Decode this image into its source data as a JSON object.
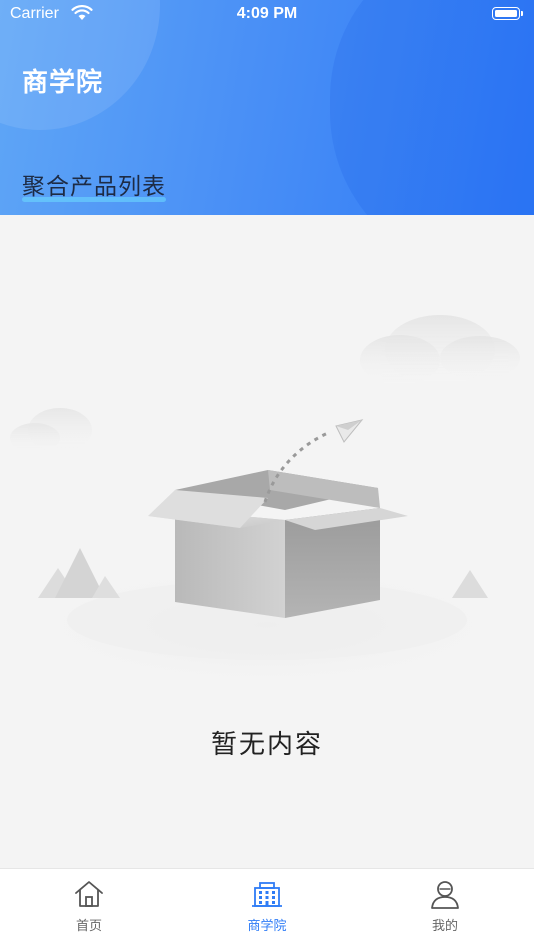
{
  "status_bar": {
    "carrier": "Carrier",
    "time": "4:09 PM"
  },
  "header": {
    "title": "商学院",
    "section_tab": "聚合产品列表"
  },
  "empty_state": {
    "message": "暂无内容"
  },
  "tab_bar": {
    "items": [
      {
        "label": "首页",
        "icon": "home-icon",
        "active": false
      },
      {
        "label": "商学院",
        "icon": "building-icon",
        "active": true
      },
      {
        "label": "我的",
        "icon": "user-icon",
        "active": false
      }
    ]
  },
  "colors": {
    "header_gradient_start": "#5fa6f6",
    "header_gradient_end": "#2e79f7",
    "active_tab": "#2f7cf6",
    "inactive_tab": "#666666",
    "background": "#f4f4f4"
  }
}
